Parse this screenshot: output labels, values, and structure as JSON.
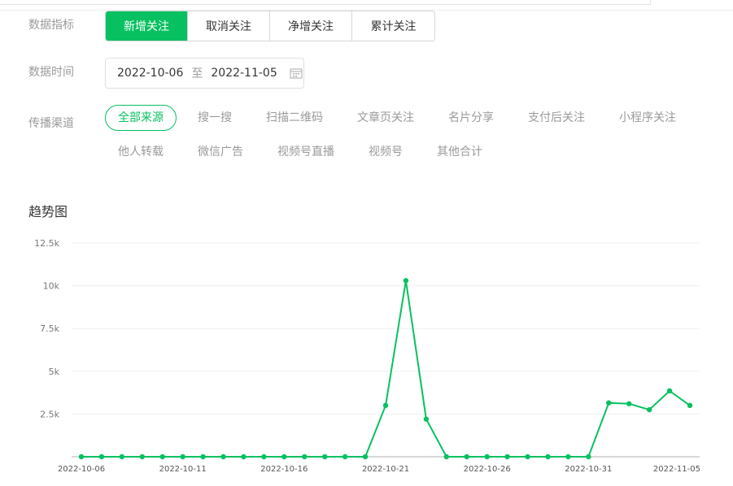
{
  "metric": {
    "label": "数据指标",
    "tabs": [
      {
        "label": "新增关注",
        "active": true
      },
      {
        "label": "取消关注",
        "active": false
      },
      {
        "label": "净增关注",
        "active": false
      },
      {
        "label": "累计关注",
        "active": false
      }
    ]
  },
  "time": {
    "label": "数据时间",
    "start": "2022-10-06",
    "separator": "至",
    "end": "2022-11-05",
    "icon": "calendar-icon"
  },
  "channel": {
    "label": "传播渠道",
    "options": [
      {
        "label": "全部来源",
        "active": true
      },
      {
        "label": "搜一搜",
        "active": false
      },
      {
        "label": "扫描二维码",
        "active": false
      },
      {
        "label": "文章页关注",
        "active": false
      },
      {
        "label": "名片分享",
        "active": false
      },
      {
        "label": "支付后关注",
        "active": false
      },
      {
        "label": "小程序关注",
        "active": false
      },
      {
        "label": "他人转载",
        "active": false
      },
      {
        "label": "微信广告",
        "active": false
      },
      {
        "label": "视频号直播",
        "active": false
      },
      {
        "label": "视频号",
        "active": false
      },
      {
        "label": "其他合计",
        "active": false
      }
    ]
  },
  "trend": {
    "title": "趋势图"
  },
  "colors": {
    "accent": "#07c160",
    "muted": "#9a9a9a",
    "grid": "#efefef",
    "axis": "#cccccc"
  },
  "chart_data": {
    "type": "line",
    "title": "",
    "xlabel": "",
    "ylabel": "",
    "ylim": [
      0,
      12500
    ],
    "yticks": [
      2500,
      5000,
      7500,
      10000,
      12500
    ],
    "ytick_labels": [
      "2.5k",
      "5k",
      "7.5k",
      "10k",
      "12.5k"
    ],
    "xtick_labels": [
      "2022-10-06",
      "2022-10-11",
      "2022-10-16",
      "2022-10-21",
      "2022-10-26",
      "2022-10-31",
      "2022-11-05"
    ],
    "grid": true,
    "x": [
      "2022-10-06",
      "2022-10-07",
      "2022-10-08",
      "2022-10-09",
      "2022-10-10",
      "2022-10-11",
      "2022-10-12",
      "2022-10-13",
      "2022-10-14",
      "2022-10-15",
      "2022-10-16",
      "2022-10-17",
      "2022-10-18",
      "2022-10-19",
      "2022-10-20",
      "2022-10-21",
      "2022-10-22",
      "2022-10-23",
      "2022-10-24",
      "2022-10-25",
      "2022-10-26",
      "2022-10-27",
      "2022-10-28",
      "2022-10-29",
      "2022-10-30",
      "2022-10-31",
      "2022-11-01",
      "2022-11-02",
      "2022-11-03",
      "2022-11-04",
      "2022-11-05"
    ],
    "values": [
      0,
      0,
      0,
      0,
      0,
      0,
      0,
      0,
      0,
      0,
      0,
      0,
      0,
      0,
      0,
      3000,
      10300,
      2200,
      0,
      0,
      0,
      0,
      0,
      0,
      0,
      0,
      3150,
      3100,
      2750,
      3850,
      3000
    ]
  }
}
